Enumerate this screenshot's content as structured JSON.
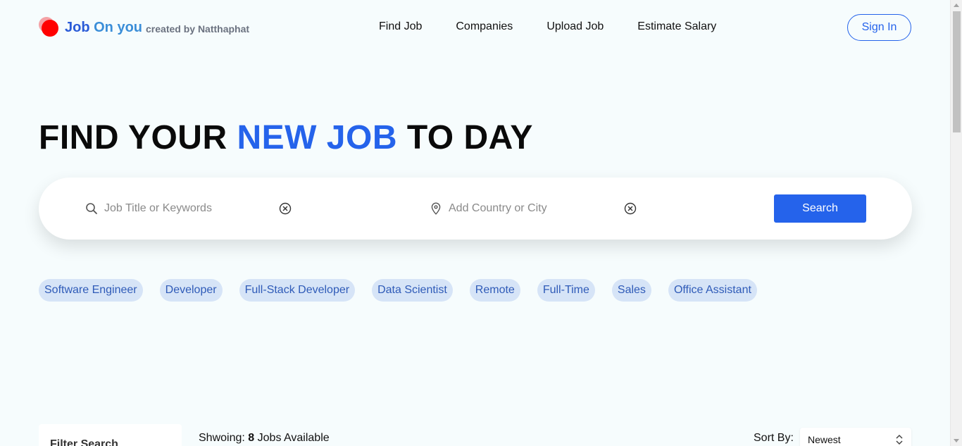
{
  "header": {
    "logo_job": "Job",
    "logo_on_you": "On you",
    "logo_sub": "created by Natthaphat",
    "nav": [
      {
        "label": "Find Job"
      },
      {
        "label": "Companies"
      },
      {
        "label": "Upload Job"
      },
      {
        "label": "Estimate Salary"
      }
    ],
    "signin_label": "Sign In"
  },
  "hero": {
    "title_part1": "FIND YOUR",
    "title_accent": "NEW JOB",
    "title_part2": "TO DAY"
  },
  "search": {
    "keyword_placeholder": "Job Title or Keywords",
    "location_placeholder": "Add Country or City",
    "button_label": "Search",
    "icons": {
      "keyword": "search-icon",
      "location": "map-pin-icon",
      "clear": "clear-circle-icon"
    }
  },
  "tags": [
    {
      "label": "Software Engineer"
    },
    {
      "label": "Developer"
    },
    {
      "label": "Full-Stack Developer"
    },
    {
      "label": "Data Scientist"
    },
    {
      "label": "Remote"
    },
    {
      "label": "Full-Time"
    },
    {
      "label": "Sales"
    },
    {
      "label": "Office Assistant"
    }
  ],
  "results": {
    "filter_title": "Filter Search",
    "showing_prefix": "Shwoing:",
    "showing_count": "8",
    "showing_suffix": "Jobs Available",
    "sort_label": "Sort By:",
    "sort_value": "Newest"
  },
  "colors": {
    "accent": "#2563eb",
    "background": "#f6fcfd",
    "tag_bg": "#d6e4f7",
    "logo_red": "#ff0000"
  }
}
